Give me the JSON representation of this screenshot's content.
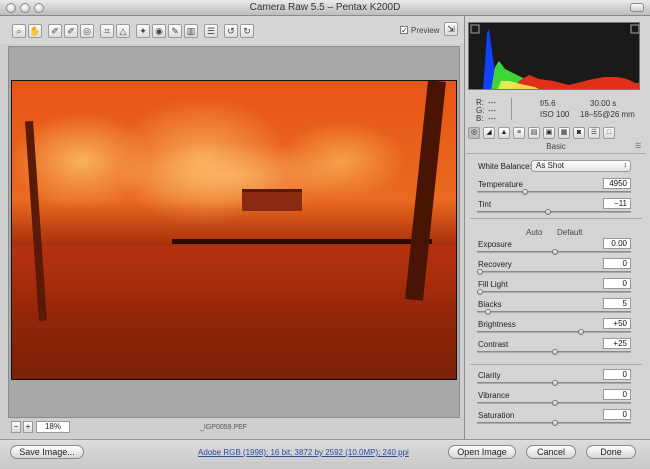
{
  "window": {
    "title": "Camera Raw 5.5  –  Pentax K200D"
  },
  "toolbar": {
    "tools": [
      "zoom-tool-icon",
      "hand-tool-icon",
      "white-balance-tool-icon",
      "color-sampler-tool-icon",
      "target-adjustment-tool-icon",
      "crop-tool-icon",
      "straighten-tool-icon",
      "spot-removal-tool-icon",
      "red-eye-tool-icon",
      "adjustment-brush-icon",
      "graduated-filter-icon",
      "preferences-icon",
      "rotate-ccw-icon",
      "rotate-cw-icon"
    ],
    "preview_label": "Preview",
    "preview_checked": true
  },
  "canvas": {
    "zoom_value": "18%",
    "filename": "_IGP0059.PEF"
  },
  "histogram": {
    "r_label": "R:",
    "g_label": "G:",
    "b_label": "B:",
    "r_value": "---",
    "g_value": "---",
    "b_value": "---",
    "aperture": "f/5.6",
    "shutter": "30.00 s",
    "iso": "ISO 100",
    "lens": "18–55@26 mm"
  },
  "panel": {
    "section_title": "Basic",
    "white_balance_label": "White Balance:",
    "white_balance_value": "As Shot",
    "auto_label": "Auto",
    "default_label": "Default",
    "controls": [
      {
        "label": "Temperature",
        "value": "4950",
        "level": 0.3
      },
      {
        "label": "Tint",
        "value": "−11",
        "level": 0.45
      },
      {
        "label": "Exposure",
        "value": "0.00",
        "level": 0.5
      },
      {
        "label": "Recovery",
        "value": "0",
        "level": 0.0
      },
      {
        "label": "Fill Light",
        "value": "0",
        "level": 0.0
      },
      {
        "label": "Blacks",
        "value": "5",
        "level": 0.05
      },
      {
        "label": "Brightness",
        "value": "+50",
        "level": 0.67
      },
      {
        "label": "Contrast",
        "value": "+25",
        "level": 0.5
      },
      {
        "label": "Clarity",
        "value": "0",
        "level": 0.5
      },
      {
        "label": "Vibrance",
        "value": "0",
        "level": 0.5
      },
      {
        "label": "Saturation",
        "value": "0",
        "level": 0.5
      }
    ]
  },
  "footer": {
    "save_label": "Save Image...",
    "workflow_text": "Adobe RGB (1998); 16 bit; 3872 by 2592 (10.0MP); 240 ppi",
    "open_label": "Open Image",
    "cancel_label": "Cancel",
    "done_label": "Done"
  }
}
